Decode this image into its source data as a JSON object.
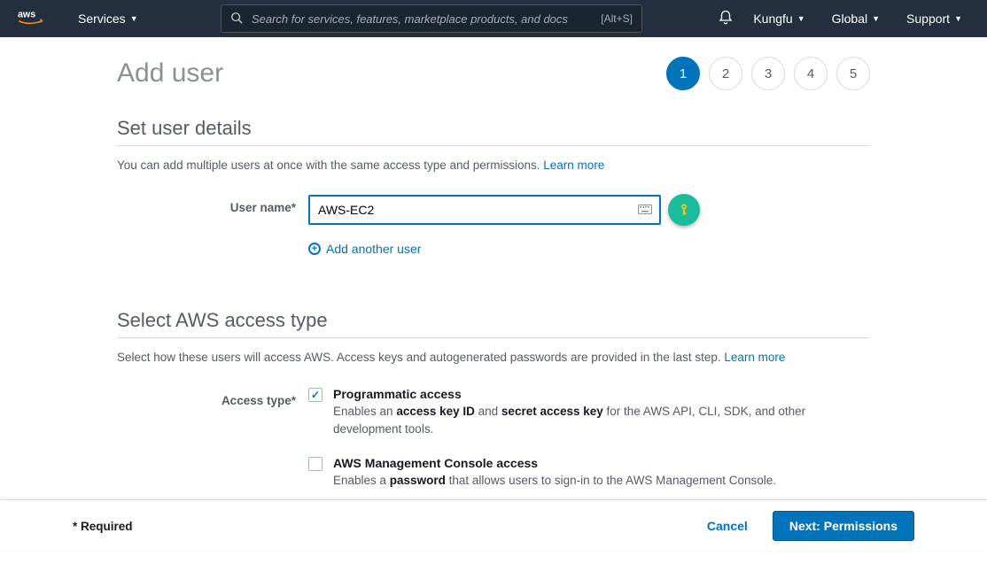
{
  "nav": {
    "services": "Services",
    "search_placeholder": "Search for services, features, marketplace products, and docs",
    "search_shortcut": "[Alt+S]",
    "user": "Kungfu",
    "region": "Global",
    "support": "Support"
  },
  "page": {
    "title": "Add user"
  },
  "steps": [
    "1",
    "2",
    "3",
    "4",
    "5"
  ],
  "section1": {
    "title": "Set user details",
    "desc": "You can add multiple users at once with the same access type and permissions.",
    "learn_more": "Learn more",
    "username_label": "User name*",
    "username_value": "AWS-EC2",
    "add_another": "Add another user"
  },
  "section2": {
    "title": "Select AWS access type",
    "desc": "Select how these users will access AWS. Access keys and autogenerated passwords are provided in the last step.",
    "learn_more": "Learn more",
    "access_type_label": "Access type*",
    "opt1": {
      "title": "Programmatic access",
      "pre": "Enables an ",
      "b1": "access key ID",
      "mid": " and ",
      "b2": "secret access key",
      "post": " for the AWS API, CLI, SDK, and other development tools."
    },
    "opt2": {
      "title": "AWS Management Console access",
      "pre": "Enables a ",
      "b1": "password",
      "post": " that allows users to sign-in to the AWS Management Console."
    }
  },
  "footer": {
    "required": "* Required",
    "cancel": "Cancel",
    "next": "Next: Permissions"
  }
}
